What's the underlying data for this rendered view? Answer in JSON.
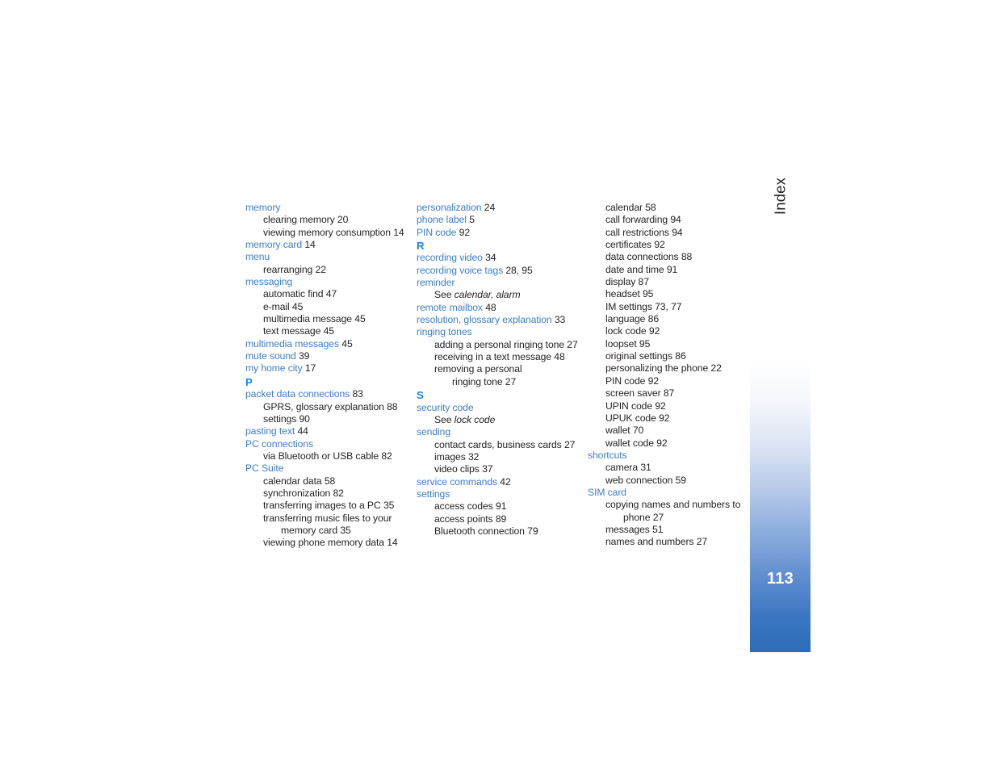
{
  "document": {
    "section_label": "Index",
    "page_number": "113",
    "link_color": "#3d7dc9",
    "text_color": "#231f20",
    "tab_accent_color": "#2c6cb7"
  },
  "columns": [
    {
      "id": "column-1",
      "entries": [
        {
          "level": 0,
          "term": "memory",
          "page": ""
        },
        {
          "level": 1,
          "term": "clearing memory",
          "page": "20"
        },
        {
          "level": 1,
          "term": "viewing memory consumption",
          "page": "14"
        },
        {
          "level": 0,
          "term": "memory card",
          "page": "14"
        },
        {
          "level": 0,
          "term": "menu",
          "page": ""
        },
        {
          "level": 1,
          "term": "rearranging",
          "page": "22"
        },
        {
          "level": 0,
          "term": "messaging",
          "page": ""
        },
        {
          "level": 1,
          "term": "automatic find",
          "page": "47"
        },
        {
          "level": 1,
          "term": "e-mail",
          "page": "45"
        },
        {
          "level": 1,
          "term": "multimedia message",
          "page": "45"
        },
        {
          "level": 1,
          "term": "text message",
          "page": "45"
        },
        {
          "level": 0,
          "term": "multimedia messages",
          "page": "45"
        },
        {
          "level": 0,
          "term": "mute sound",
          "page": "39"
        },
        {
          "level": 0,
          "term": "my home city",
          "page": "17"
        },
        {
          "heading": "P"
        },
        {
          "level": 0,
          "term": "packet data connections",
          "page": "83"
        },
        {
          "level": 1,
          "term": "GPRS, glossary explanation",
          "page": "88"
        },
        {
          "level": 1,
          "term": "settings",
          "page": "90"
        },
        {
          "level": 0,
          "term": "pasting text",
          "page": "44"
        },
        {
          "level": 0,
          "term": "PC connections",
          "page": ""
        },
        {
          "level": 1,
          "term": "via Bluetooth or USB cable",
          "page": "82"
        },
        {
          "level": 0,
          "term": "PC Suite",
          "page": ""
        },
        {
          "level": 1,
          "term": "calendar data",
          "page": "58"
        },
        {
          "level": 1,
          "term": "synchronization",
          "page": "82"
        },
        {
          "level": 1,
          "term": "transferring images to a PC",
          "page": "35"
        },
        {
          "level": 1,
          "term": "transferring music files to your",
          "page": ""
        },
        {
          "level": 2,
          "term": "memory card",
          "page": "35"
        },
        {
          "level": 1,
          "term": "viewing phone memory data",
          "page": "14"
        }
      ]
    },
    {
      "id": "column-2",
      "entries": [
        {
          "level": 0,
          "term": "personalization",
          "page": "24"
        },
        {
          "level": 0,
          "term": "phone label",
          "page": "5"
        },
        {
          "level": 0,
          "term": "PIN code",
          "page": "92"
        },
        {
          "heading": "R"
        },
        {
          "level": 0,
          "term": "recording video",
          "page": "34"
        },
        {
          "level": 0,
          "term": "recording voice tags",
          "page": "28, 95"
        },
        {
          "level": 0,
          "term": "reminder",
          "page": ""
        },
        {
          "level": 1,
          "term": "See ",
          "italic": "calendar, alarm",
          "page": ""
        },
        {
          "level": 0,
          "term": "remote mailbox",
          "page": "48"
        },
        {
          "level": 0,
          "term": "resolution, glossary explanation",
          "page": "33"
        },
        {
          "level": 0,
          "term": "ringing tones",
          "page": ""
        },
        {
          "level": 1,
          "term": "adding a personal ringing tone",
          "page": "27"
        },
        {
          "level": 1,
          "term": "receiving in a text message",
          "page": "48"
        },
        {
          "level": 1,
          "term": "removing a personal",
          "page": ""
        },
        {
          "level": 2,
          "term": "ringing tone",
          "page": "27"
        },
        {
          "heading": "S"
        },
        {
          "level": 0,
          "term": "security code",
          "page": ""
        },
        {
          "level": 1,
          "term": "See ",
          "italic": "lock code",
          "page": ""
        },
        {
          "level": 0,
          "term": "sending",
          "page": ""
        },
        {
          "level": 1,
          "term": "contact cards, business cards",
          "page": "27"
        },
        {
          "level": 1,
          "term": "images",
          "page": "32"
        },
        {
          "level": 1,
          "term": "video clips",
          "page": "37"
        },
        {
          "level": 0,
          "term": "service commands",
          "page": "42"
        },
        {
          "level": 0,
          "term": "settings",
          "page": ""
        },
        {
          "level": 1,
          "term": "access codes",
          "page": "91"
        },
        {
          "level": 1,
          "term": "access points",
          "page": "89"
        },
        {
          "level": 1,
          "term": "Bluetooth connection",
          "page": "79"
        }
      ]
    },
    {
      "id": "column-3",
      "entries": [
        {
          "level": 1,
          "term": "calendar",
          "page": "58"
        },
        {
          "level": 1,
          "term": "call forwarding",
          "page": "94"
        },
        {
          "level": 1,
          "term": "call restrictions",
          "page": "94"
        },
        {
          "level": 1,
          "term": "certificates",
          "page": "92"
        },
        {
          "level": 1,
          "term": "data connections",
          "page": "88"
        },
        {
          "level": 1,
          "term": "date and time",
          "page": "91"
        },
        {
          "level": 1,
          "term": "display",
          "page": "87"
        },
        {
          "level": 1,
          "term": "headset",
          "page": "95"
        },
        {
          "level": 1,
          "term": "IM settings",
          "page": "73, 77"
        },
        {
          "level": 1,
          "term": "language",
          "page": "86"
        },
        {
          "level": 1,
          "term": "lock code",
          "page": "92"
        },
        {
          "level": 1,
          "term": "loopset",
          "page": "95"
        },
        {
          "level": 1,
          "term": "original settings",
          "page": "86"
        },
        {
          "level": 1,
          "term": "personalizing the phone",
          "page": "22"
        },
        {
          "level": 1,
          "term": "PIN code",
          "page": "92"
        },
        {
          "level": 1,
          "term": "screen saver",
          "page": "87"
        },
        {
          "level": 1,
          "term": "UPIN code",
          "page": "92"
        },
        {
          "level": 1,
          "term": "UPUK code",
          "page": "92"
        },
        {
          "level": 1,
          "term": "wallet",
          "page": "70"
        },
        {
          "level": 1,
          "term": "wallet code",
          "page": "92"
        },
        {
          "level": 0,
          "term": "shortcuts",
          "page": ""
        },
        {
          "level": 1,
          "term": "camera",
          "page": "31"
        },
        {
          "level": 1,
          "term": "web connection",
          "page": "59"
        },
        {
          "level": 0,
          "term": "SIM card",
          "page": ""
        },
        {
          "level": 1,
          "term": "copying names and numbers to",
          "page": ""
        },
        {
          "level": 2,
          "term": "phone",
          "page": "27"
        },
        {
          "level": 1,
          "term": "messages",
          "page": "51"
        },
        {
          "level": 1,
          "term": "names and numbers",
          "page": "27"
        }
      ]
    }
  ]
}
